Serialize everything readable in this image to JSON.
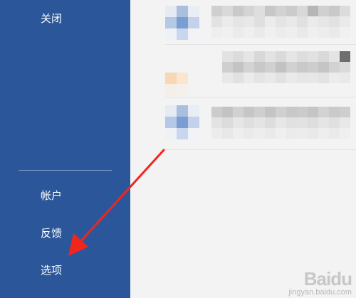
{
  "sidebar": {
    "items": [
      {
        "id": "close",
        "label": "关闭"
      },
      {
        "id": "account",
        "label": "帐户"
      },
      {
        "id": "feedback",
        "label": "反馈"
      },
      {
        "id": "options",
        "label": "选项"
      }
    ]
  },
  "annotation": {
    "arrow_icon": "red-arrow-icon",
    "color": "#f0261d"
  },
  "colors": {
    "sidebar": "#2b579a",
    "content": "#f3f3f3",
    "text": "#ffffff"
  },
  "watermark": {
    "logo": "Baidu",
    "sub": "jingyan.baidu.com"
  }
}
